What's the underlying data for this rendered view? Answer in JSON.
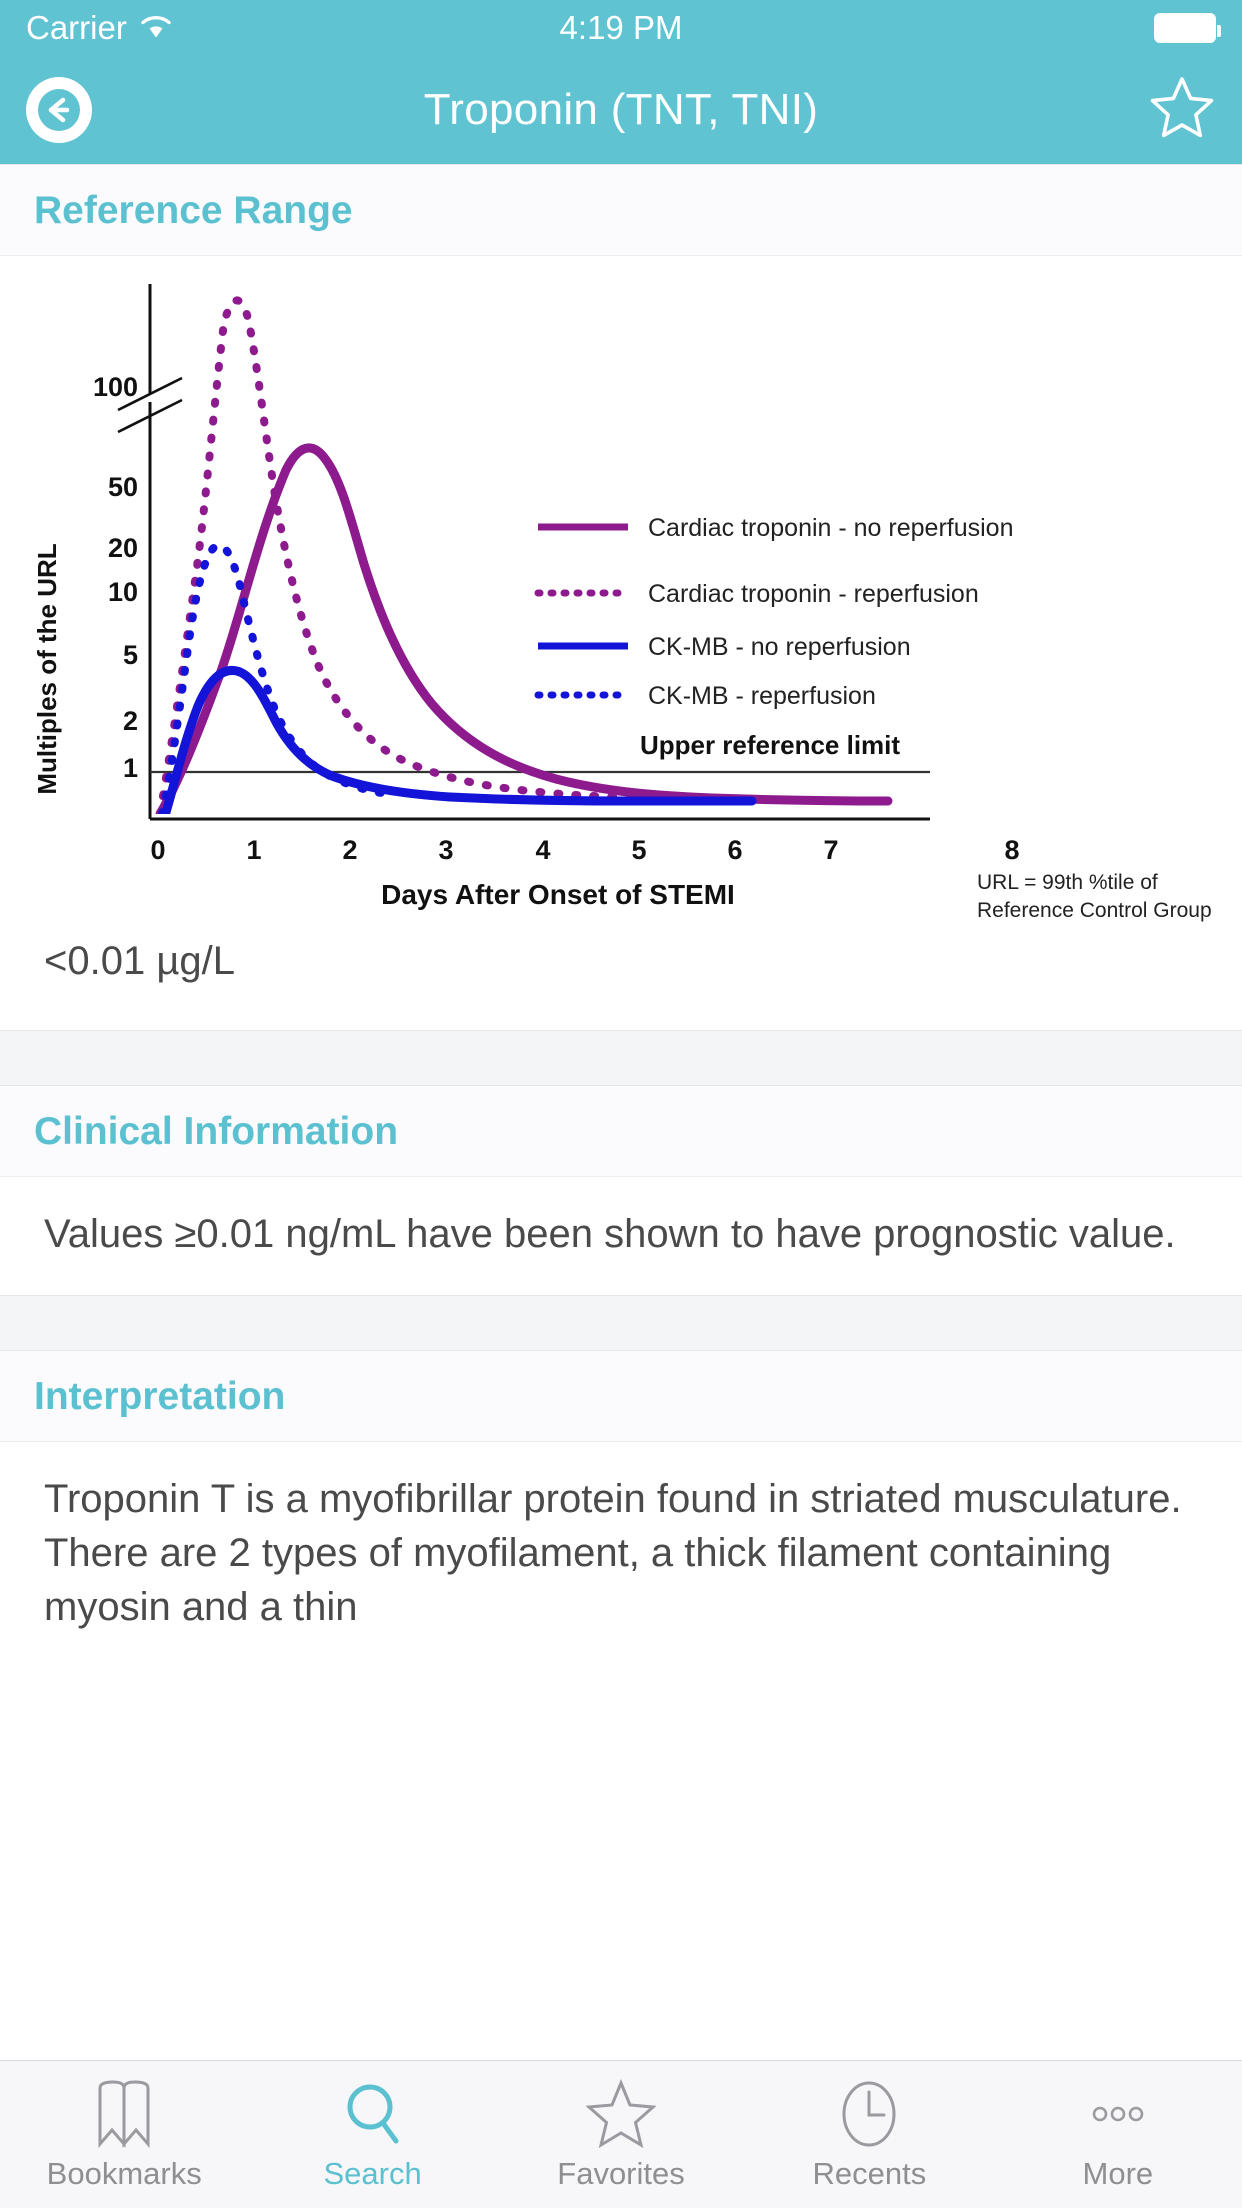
{
  "status_bar": {
    "carrier": "Carrier",
    "time": "4:19 PM",
    "wifi_icon": "wifi-icon",
    "battery_icon": "battery-icon"
  },
  "nav": {
    "title": "Troponin (TNT, TNI)",
    "back_icon": "back-arrow-icon",
    "favorite_icon": "star-outline-icon"
  },
  "sections": {
    "reference_range": {
      "title": "Reference Range",
      "value": "<0.01 µg/L"
    },
    "clinical_information": {
      "title": "Clinical Information",
      "body": "Values ≥0.01 ng/mL have been shown to have prognostic value."
    },
    "interpretation": {
      "title": "Interpretation",
      "body": "Troponin T is a myofibrillar protein found in striated musculature.   There are 2 types of myofilament, a thick filament containing  myosin and a thin"
    }
  },
  "chart_data": {
    "type": "line",
    "title": "",
    "xlabel": "Days After Onset of STEMI",
    "ylabel": "Multiples of the URL",
    "x_ticks": [
      "0",
      "1",
      "2",
      "3",
      "4",
      "5",
      "6",
      "7",
      "8"
    ],
    "y_ticks": [
      "100",
      "50",
      "20",
      "10",
      "5",
      "2",
      "1"
    ],
    "y_scale": "log",
    "y_axis_break": true,
    "y_axis_break_at": "100",
    "grid": false,
    "legend_position": "inside-right",
    "annotations": [
      {
        "text": "Upper reference limit",
        "value": 1
      },
      {
        "text": "URL = 99th %tile of",
        "value": null
      },
      {
        "text": "Reference Control Group",
        "value": null
      }
    ],
    "series": [
      {
        "name": "Cardiac troponin - no reperfusion",
        "color": "#8E1B8E",
        "style": "solid",
        "points": [
          [
            0.05,
            0.8
          ],
          [
            0.3,
            1.3
          ],
          [
            0.6,
            3
          ],
          [
            0.9,
            12
          ],
          [
            1.2,
            45
          ],
          [
            1.45,
            80
          ],
          [
            1.7,
            72
          ],
          [
            2.0,
            50
          ],
          [
            2.4,
            30
          ],
          [
            2.9,
            17
          ],
          [
            3.4,
            10
          ],
          [
            4.0,
            6
          ],
          [
            4.6,
            3.8
          ],
          [
            5.2,
            2.4
          ],
          [
            5.8,
            1.6
          ],
          [
            6.4,
            1.2
          ],
          [
            7.0,
            0.95
          ],
          [
            7.6,
            0.82
          ],
          [
            8.0,
            0.78
          ]
        ]
      },
      {
        "name": "Cardiac troponin - reperfusion",
        "color": "#8E1B8E",
        "style": "dotted",
        "points": [
          [
            0.05,
            0.8
          ],
          [
            0.25,
            3
          ],
          [
            0.45,
            14
          ],
          [
            0.6,
            45
          ],
          [
            0.72,
            130
          ],
          [
            0.85,
            230
          ],
          [
            0.95,
            300
          ],
          [
            1.1,
            240
          ],
          [
            1.25,
            150
          ],
          [
            1.4,
            85
          ],
          [
            1.6,
            45
          ],
          [
            1.85,
            24
          ],
          [
            2.15,
            13
          ],
          [
            2.5,
            7
          ],
          [
            2.9,
            4
          ],
          [
            3.3,
            2.6
          ],
          [
            3.8,
            1.8
          ],
          [
            4.2,
            1.3
          ],
          [
            4.5,
            1.05
          ]
        ]
      },
      {
        "name": "CK-MB - no reperfusion",
        "color": "#1414D8",
        "style": "solid",
        "points": [
          [
            0.1,
            0.4
          ],
          [
            0.3,
            1.1
          ],
          [
            0.5,
            2.2
          ],
          [
            0.7,
            3.6
          ],
          [
            0.85,
            4.0
          ],
          [
            1.0,
            3.6
          ],
          [
            1.25,
            2.8
          ],
          [
            1.55,
            2.0
          ],
          [
            1.9,
            1.5
          ],
          [
            2.3,
            1.2
          ],
          [
            2.8,
            1.0
          ],
          [
            3.4,
            0.85
          ],
          [
            4.0,
            0.78
          ],
          [
            4.6,
            0.74
          ],
          [
            5.2,
            0.72
          ],
          [
            5.7,
            0.7
          ]
        ]
      },
      {
        "name": "CK-MB - reperfusion",
        "color": "#1414D8",
        "style": "dotted",
        "points": [
          [
            0.1,
            0.5
          ],
          [
            0.25,
            2
          ],
          [
            0.4,
            6
          ],
          [
            0.52,
            13
          ],
          [
            0.62,
            19
          ],
          [
            0.72,
            21
          ],
          [
            0.85,
            17
          ],
          [
            1.0,
            11
          ],
          [
            1.2,
            6
          ],
          [
            1.4,
            3.4
          ],
          [
            1.6,
            2.2
          ],
          [
            1.85,
            1.5
          ],
          [
            2.1,
            1.1
          ],
          [
            2.35,
            0.9
          ],
          [
            2.6,
            0.82
          ]
        ]
      }
    ]
  },
  "tab_bar": {
    "items": [
      {
        "label": "Bookmarks",
        "icon": "bookmarks-icon",
        "active": false
      },
      {
        "label": "Search",
        "icon": "search-icon",
        "active": true
      },
      {
        "label": "Favorites",
        "icon": "star-icon",
        "active": false
      },
      {
        "label": "Recents",
        "icon": "clock-icon",
        "active": false
      },
      {
        "label": "More",
        "icon": "ellipsis-icon",
        "active": false
      }
    ]
  },
  "colors": {
    "brand_teal": "#5FC3D2",
    "section_title": "#5BC0D0",
    "troponin_purple": "#8E1B8E",
    "ckmb_blue": "#1414D8"
  }
}
